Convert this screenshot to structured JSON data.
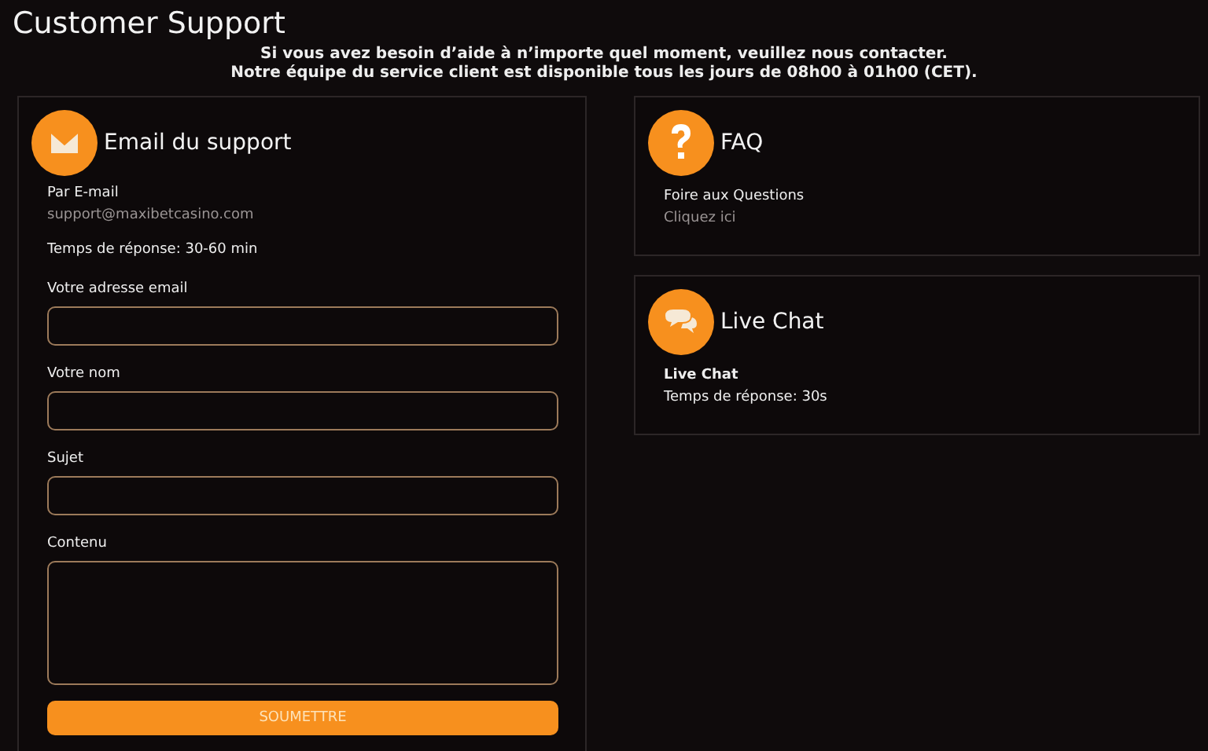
{
  "page_title": "Customer Support",
  "intro": [
    "Si vous avez besoin d’aide à n’importe quel moment, veuillez nous contacter.",
    "Notre équipe du service client est disponible tous les jours de 08h00 à 01h00 (CET)."
  ],
  "email_card": {
    "title": "Email du support",
    "method_label": "Par E-mail",
    "address": "support@maxibetcasino.com",
    "response_time": "Temps de réponse: 30-60 min",
    "fields": [
      {
        "label": "Votre adresse email",
        "kind": "input"
      },
      {
        "label": "Votre nom",
        "kind": "input"
      },
      {
        "label": "Sujet",
        "kind": "input"
      },
      {
        "label": "Contenu",
        "kind": "textarea"
      }
    ],
    "submit": "SOUMETTRE"
  },
  "side_cards": [
    {
      "kind": "faq",
      "title": "FAQ",
      "line_1": "Foire aux Questions",
      "line_2": "Cliquez ici"
    },
    {
      "kind": "chat",
      "title": "Live Chat",
      "line_1": "Live Chat",
      "line_2": "Temps de réponse: 30s"
    }
  ]
}
